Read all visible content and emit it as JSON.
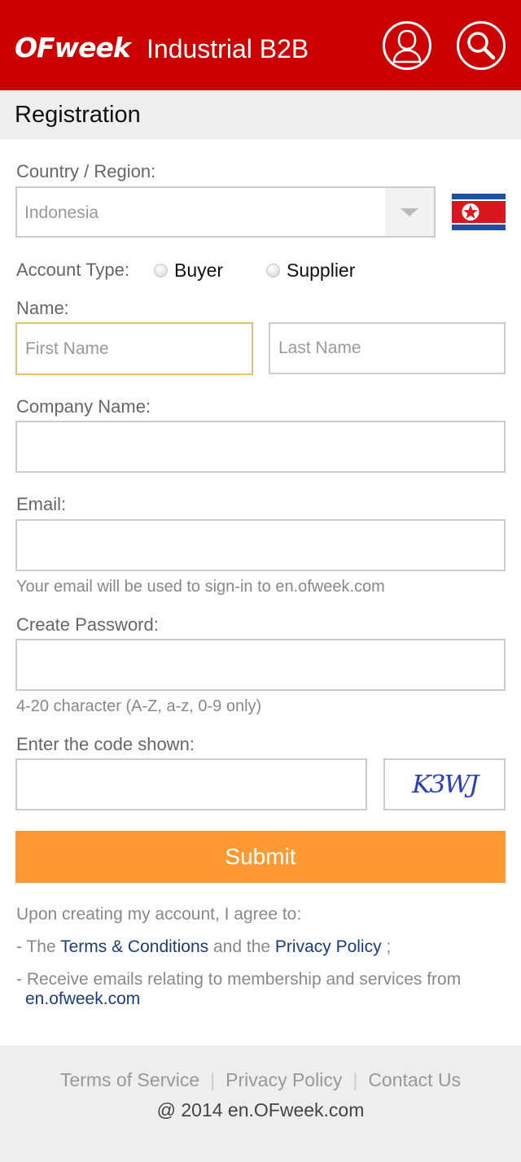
{
  "header": {
    "logo_text": "OFweek",
    "title": "Industrial B2B",
    "user_icon": "user-icon",
    "search_icon": "search-icon",
    "background_color": "#cc0000"
  },
  "page": {
    "title": "Registration"
  },
  "form": {
    "country": {
      "label": "Country / Region:",
      "selected": "Indonesia",
      "flag_icon": "flag-icon"
    },
    "account_type": {
      "label": "Account Type:",
      "options": [
        "Buyer",
        "Supplier"
      ]
    },
    "name": {
      "label": "Name:",
      "first_placeholder": "First Name",
      "last_placeholder": "Last Name"
    },
    "company": {
      "label": "Company Name:"
    },
    "email": {
      "label": "Email:",
      "hint": "Your email will be used to sign-in to en.ofweek.com"
    },
    "password": {
      "label": "Create Password:",
      "hint": "4-20 character (A-Z, a-z, 0-9 only)"
    },
    "captcha": {
      "label": "Enter the code shown:",
      "code": "K3WJ"
    },
    "submit_label": "Submit",
    "submit_color": "#ff9933"
  },
  "agreement": {
    "intro": "Upon creating my account, I agree to:",
    "line1_prefix": "- The ",
    "terms_link": "Terms & Conditions",
    "line1_mid": " and the ",
    "privacy_link": "Privacy Policy",
    "line1_suffix": " ;",
    "line2_prefix": "- Receive emails relating to membership and services from",
    "site_link": "en.ofweek.com"
  },
  "footer": {
    "links": [
      "Terms of Service",
      "Privacy Policy",
      "Contact Us"
    ],
    "separator": "|",
    "copyright": "@ 2014 en.OFweek.com"
  }
}
